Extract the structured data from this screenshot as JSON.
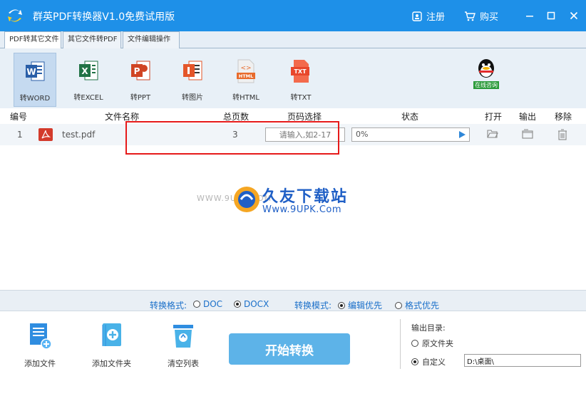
{
  "app": {
    "title": "群英PDF转换器V1.0免费试用版",
    "register_label": "注册",
    "buy_label": "购买"
  },
  "tabs": [
    {
      "label": "PDF转其它文件",
      "active": true
    },
    {
      "label": "其它文件转PDF",
      "active": false
    },
    {
      "label": "文件编辑操作",
      "active": false
    }
  ],
  "toolbar": {
    "items": [
      {
        "label": "转WORD",
        "icon": "word-icon",
        "active": true
      },
      {
        "label": "转EXCEL",
        "icon": "excel-icon"
      },
      {
        "label": "转PPT",
        "icon": "ppt-icon"
      },
      {
        "label": "转图片",
        "icon": "image-icon"
      },
      {
        "label": "转HTML",
        "icon": "html-icon"
      },
      {
        "label": "转TXT",
        "icon": "txt-icon"
      }
    ],
    "consult_label": "在线咨询"
  },
  "table": {
    "headers": {
      "num": "编号",
      "name": "文件名称",
      "pages": "总页数",
      "page_select": "页码选择",
      "status": "状态",
      "open": "打开",
      "output": "输出",
      "remove": "移除"
    },
    "rows": [
      {
        "num": "1",
        "name": "test.pdf",
        "pages": "3",
        "page_placeholder": "请输入,如2-17",
        "progress": "0%"
      }
    ]
  },
  "watermark": {
    "left": "WWW.9UPK.COM",
    "main": "久友下载站",
    "sub": "Www.9UPK.Com"
  },
  "options": {
    "format_label": "转换格式:",
    "format_options": [
      "DOC",
      "DOCX"
    ],
    "format_selected": "DOCX",
    "mode_label": "转换模式:",
    "mode_options": [
      "编辑优先",
      "格式优先"
    ],
    "mode_selected": "编辑优先"
  },
  "bottom": {
    "add_file": "添加文件",
    "add_folder": "添加文件夹",
    "clear_list": "清空列表",
    "start": "开始转换",
    "output_title": "输出目录:",
    "output_original": "原文件夹",
    "output_custom": "自定义",
    "output_path": "D:\\桌面\\",
    "output_selected": "自定义"
  },
  "colors": {
    "titlebar": "#1e90e8",
    "accent": "#1a6fc9",
    "start_button": "#5db3e8",
    "highlight_box": "#e61a1a"
  }
}
